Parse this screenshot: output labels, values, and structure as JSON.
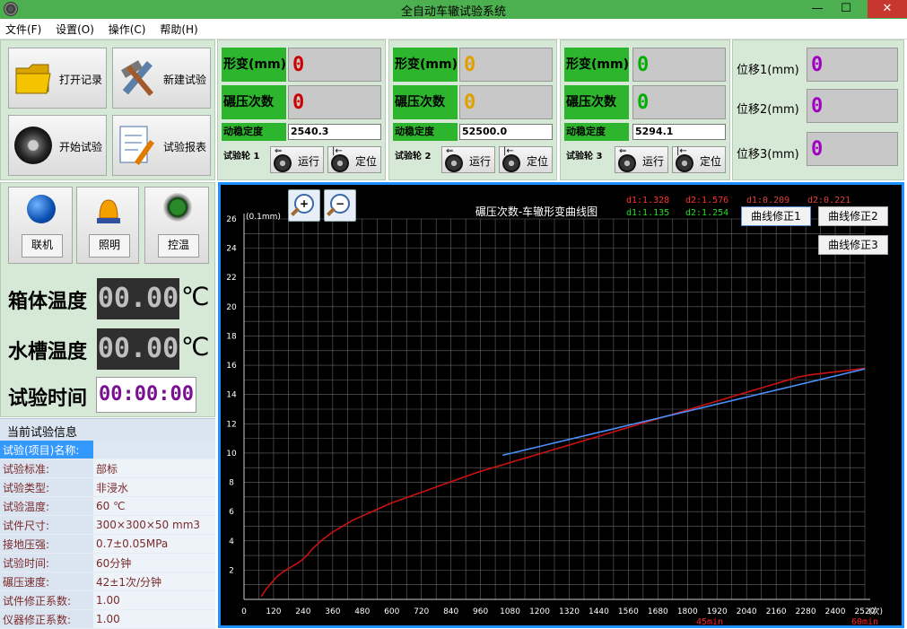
{
  "window": {
    "title": "全自动车辙试验系统",
    "minimize": "—",
    "maximize": "☐",
    "close": "✕"
  },
  "menu": [
    "文件(F)",
    "设置(O)",
    "操作(C)",
    "帮助(H)"
  ],
  "toolbar": {
    "open_record": "打开记录",
    "new_test": "新建试验",
    "start_test": "开始试验",
    "test_report": "试验报表"
  },
  "wheels": [
    {
      "deform_label": "形变(mm)",
      "deform": "0",
      "count_label": "碾压次数",
      "count": "0",
      "dyn_label": "动稳定度",
      "dyn_value": "2540.3",
      "wheel_label": "试验轮 1",
      "run": "运行",
      "locate": "定位",
      "color": "#cc0000"
    },
    {
      "deform_label": "形变(mm)",
      "deform": "0",
      "count_label": "碾压次数",
      "count": "0",
      "dyn_label": "动稳定度",
      "dyn_value": "52500.0",
      "wheel_label": "试验轮 2",
      "run": "运行",
      "locate": "定位",
      "color": "#e0a000"
    },
    {
      "deform_label": "形变(mm)",
      "deform": "0",
      "count_label": "碾压次数",
      "count": "0",
      "dyn_label": "动稳定度",
      "dyn_value": "5294.1",
      "wheel_label": "试验轮 3",
      "run": "运行",
      "locate": "定位",
      "color": "#00b000"
    }
  ],
  "displacement": [
    {
      "label": "位移1(mm)",
      "value": "0"
    },
    {
      "label": "位移2(mm)",
      "value": "0"
    },
    {
      "label": "位移3(mm)",
      "value": "0"
    }
  ],
  "controls": {
    "online": "联机",
    "light": "照明",
    "temp_ctrl": "控温"
  },
  "readouts": {
    "box_temp_label": "箱体温度",
    "box_temp": "00.00",
    "unit_c": "℃",
    "tank_temp_label": "水槽温度",
    "tank_temp": "00.00",
    "test_time_label": "试验时间",
    "test_time": "00:00:00"
  },
  "info": {
    "header": "当前试验信息",
    "rows": [
      {
        "k": "试验(项目)名称:",
        "v": ""
      },
      {
        "k": "试验标准:",
        "v": "部标"
      },
      {
        "k": "试验类型:",
        "v": "非浸水"
      },
      {
        "k": "试验温度:",
        "v": "60 ℃"
      },
      {
        "k": "试件尺寸:",
        "v": "300×300×50 mm3"
      },
      {
        "k": "接地压强:",
        "v": "0.7±0.05MPa"
      },
      {
        "k": "试验时间:",
        "v": "60分钟"
      },
      {
        "k": "碾压速度:",
        "v": "42±1次/分钟"
      },
      {
        "k": "试件修正系数:",
        "v": "1.00"
      },
      {
        "k": "仪器修正系数:",
        "v": "1.00"
      }
    ]
  },
  "chart_buttons": {
    "fix1": "曲线修正1",
    "fix2": "曲线修正2",
    "fix3": "曲线修正3",
    "zoom_in": "+",
    "zoom_out": "−"
  },
  "chart_data": {
    "type": "line",
    "title": "碾压次数-车辙形变曲线图",
    "ylabel": "(0.1mm)",
    "xunit": "(次)",
    "xlim": [
      0,
      2520
    ],
    "ylim": [
      0,
      26
    ],
    "xticks": [
      0,
      120,
      240,
      360,
      480,
      600,
      720,
      840,
      960,
      1080,
      1200,
      1320,
      1440,
      1560,
      1680,
      1800,
      1920,
      2040,
      2160,
      2280,
      2400,
      2520
    ],
    "yticks": [
      2,
      4,
      6,
      8,
      10,
      12,
      14,
      16,
      18,
      20,
      22,
      24,
      26
    ],
    "time_marks": [
      {
        "x": 1890,
        "label": "45min"
      },
      {
        "x": 2520,
        "label": "60min"
      }
    ],
    "annotations": {
      "red": [
        "d1:1.328",
        "d2:1.576"
      ],
      "green": [
        "d1:1.135",
        "d2:1.254"
      ],
      "dark": [
        "d1:0.209",
        "d2:0.221"
      ]
    },
    "series": [
      {
        "color": "#cc1111",
        "x": [
          70,
          90,
          110,
          130,
          160,
          190,
          220,
          250,
          280,
          320,
          360,
          400,
          440,
          480,
          520,
          560,
          600,
          650,
          700,
          750,
          800,
          850,
          900,
          950,
          1000,
          1050,
          1100,
          1150,
          1200,
          1250,
          1300,
          1350,
          1400,
          1450,
          1500,
          1550,
          1600,
          1650,
          1700,
          1750,
          1800,
          1850,
          1900,
          1950,
          2000,
          2050,
          2100,
          2150,
          2200,
          2250,
          2300,
          2350,
          2400,
          2450,
          2500,
          2520
        ],
        "y": [
          0.2,
          0.7,
          1.1,
          1.5,
          1.9,
          2.2,
          2.5,
          2.9,
          3.5,
          4.1,
          4.6,
          5.0,
          5.4,
          5.7,
          6.0,
          6.3,
          6.6,
          6.9,
          7.2,
          7.5,
          7.8,
          8.1,
          8.4,
          8.7,
          8.95,
          9.2,
          9.45,
          9.7,
          9.95,
          10.2,
          10.45,
          10.7,
          10.95,
          11.2,
          11.45,
          11.7,
          11.95,
          12.2,
          12.45,
          12.7,
          12.95,
          13.2,
          13.45,
          13.7,
          13.95,
          14.2,
          14.45,
          14.7,
          14.95,
          15.2,
          15.35,
          15.45,
          15.55,
          15.65,
          15.75,
          15.8
        ]
      },
      {
        "color": "#4a90ff",
        "x": [
          1050,
          2520
        ],
        "y": [
          9.85,
          15.75
        ]
      }
    ]
  }
}
